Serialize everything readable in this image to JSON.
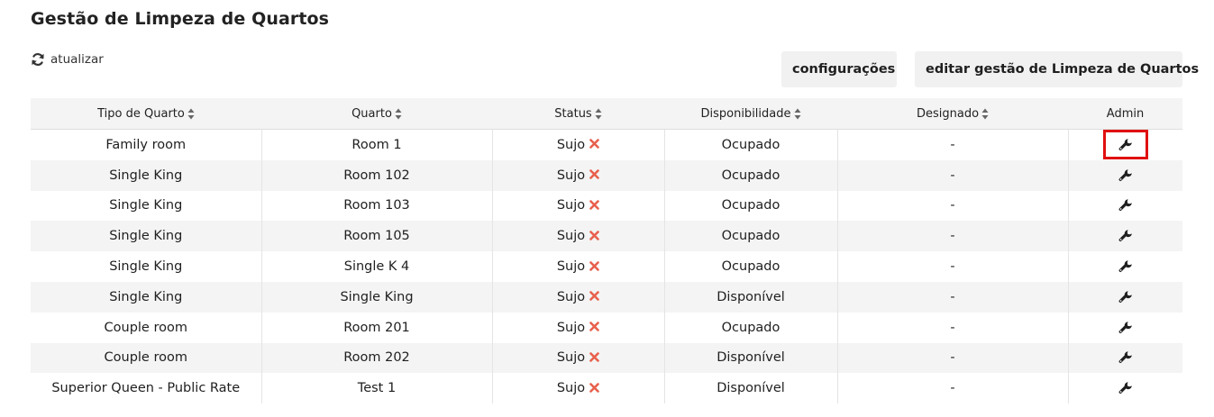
{
  "page": {
    "title": "Gestão de Limpeza de Quartos",
    "refresh_label": "atualizar"
  },
  "toolbar": {
    "config_label": "configurações",
    "edit_label": "editar gestão de Limpeza de Quartos"
  },
  "table": {
    "headers": {
      "room_type": "Tipo de Quarto",
      "room": "Quarto",
      "status": "Status",
      "availability": "Disponibilidade",
      "assigned": "Designado",
      "admin": "Admin"
    },
    "rows": [
      {
        "room_type": "Family room",
        "room": "Room 1",
        "status": "Sujo",
        "availability": "Ocupado",
        "assigned": "-"
      },
      {
        "room_type": "Single King",
        "room": "Room 102",
        "status": "Sujo",
        "availability": "Ocupado",
        "assigned": "-"
      },
      {
        "room_type": "Single King",
        "room": "Room 103",
        "status": "Sujo",
        "availability": "Ocupado",
        "assigned": "-"
      },
      {
        "room_type": "Single King",
        "room": "Room 105",
        "status": "Sujo",
        "availability": "Ocupado",
        "assigned": "-"
      },
      {
        "room_type": "Single King",
        "room": "Single K 4",
        "status": "Sujo",
        "availability": "Ocupado",
        "assigned": "-"
      },
      {
        "room_type": "Single King",
        "room": "Single King",
        "status": "Sujo",
        "availability": "Disponível",
        "assigned": "-"
      },
      {
        "room_type": "Couple room",
        "room": "Room 201",
        "status": "Sujo",
        "availability": "Ocupado",
        "assigned": "-"
      },
      {
        "room_type": "Couple room",
        "room": "Room 202",
        "status": "Sujo",
        "availability": "Disponível",
        "assigned": "-"
      },
      {
        "room_type": "Superior Queen - Public Rate",
        "room": "Test 1",
        "status": "Sujo",
        "availability": "Disponível",
        "assigned": "-"
      }
    ]
  },
  "icons": {
    "refresh": "refresh-icon",
    "sort": "sort-icon",
    "status_dirty": "x-icon",
    "admin": "wrench-icon"
  },
  "colors": {
    "dirty_mark": "#e8604c",
    "highlight_border": "#e01010"
  }
}
